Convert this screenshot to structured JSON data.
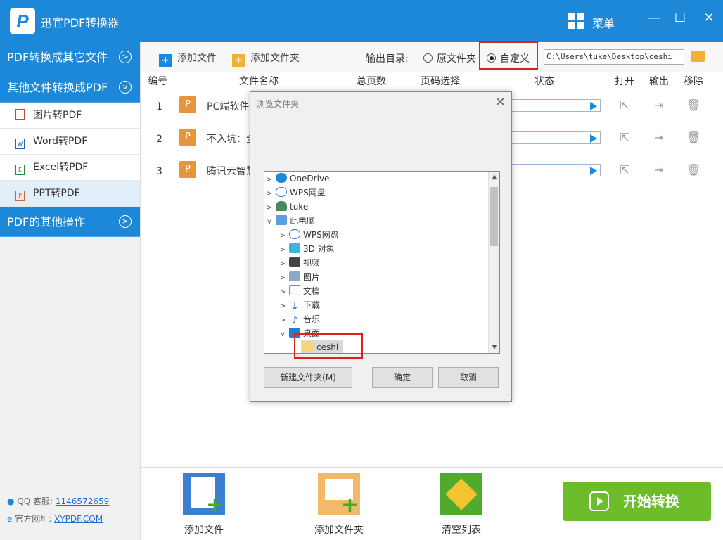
{
  "app": {
    "title": "迅宜PDF转换器",
    "logo_letter": "P",
    "menu_label": "菜单"
  },
  "sidebar": {
    "section1": "PDF转换成其它文件",
    "section2": "其他文件转换成PDF",
    "items": [
      {
        "label": "图片转PDF",
        "icon": "image-file-icon"
      },
      {
        "label": "Word转PDF",
        "icon": "word-file-icon"
      },
      {
        "label": "Excel转PDF",
        "icon": "excel-file-icon"
      },
      {
        "label": "PPT转PDF",
        "icon": "ppt-file-icon",
        "active": true
      }
    ],
    "section3": "PDF的其他操作",
    "qq_label": "QQ 客服:",
    "qq_value": "1146572659",
    "site_label": "官方网址:",
    "site_value": "XYPDF.COM"
  },
  "toolbar": {
    "add_file": "添加文件",
    "add_folder": "添加文件夹",
    "output_label": "输出目录:",
    "radio_original": "原文件夹",
    "radio_custom": "自定义",
    "path": "C:\\Users\\tuke\\Desktop\\ceshi"
  },
  "table": {
    "headers": {
      "num": "编号",
      "name": "文件名称",
      "pages": "总页数",
      "range": "页码选择",
      "status": "状态",
      "open": "打开",
      "output": "输出",
      "remove": "移除"
    },
    "rows": [
      {
        "num": "1",
        "name": "PC端软件"
      },
      {
        "num": "2",
        "name": "不入坑：全"
      },
      {
        "num": "3",
        "name": "腾讯云智慧"
      }
    ]
  },
  "bottom": {
    "add_file": "添加文件",
    "add_folder": "添加文件夹",
    "clear": "清空列表",
    "start": "开始转换"
  },
  "dialog": {
    "title": "浏览文件夹",
    "tree": [
      {
        "label": "OneDrive",
        "icon": "onedrive-icon"
      },
      {
        "label": "WPS网盘",
        "icon": "cloud-icon"
      },
      {
        "label": "tuke",
        "icon": "user-icon"
      },
      {
        "label": "此电脑",
        "icon": "computer-icon"
      },
      {
        "label": "WPS网盘",
        "icon": "cloud-icon"
      },
      {
        "label": "3D 对象",
        "icon": "3d-objects-icon"
      },
      {
        "label": "视频",
        "icon": "video-icon"
      },
      {
        "label": "图片",
        "icon": "pictures-icon"
      },
      {
        "label": "文档",
        "icon": "documents-icon"
      },
      {
        "label": "下载",
        "icon": "download-icon"
      },
      {
        "label": "音乐",
        "icon": "music-icon"
      },
      {
        "label": "桌面",
        "icon": "desktop-icon"
      },
      {
        "label": "ceshi",
        "icon": "folder-icon",
        "selected": true
      }
    ],
    "new_folder": "新建文件夹(M)",
    "ok": "确定",
    "cancel": "取消"
  },
  "colors": {
    "primary": "#1e88d8",
    "start_button": "#6dbd2a",
    "highlight_box": "#e02020",
    "ppt_icon": "#e6953a"
  }
}
